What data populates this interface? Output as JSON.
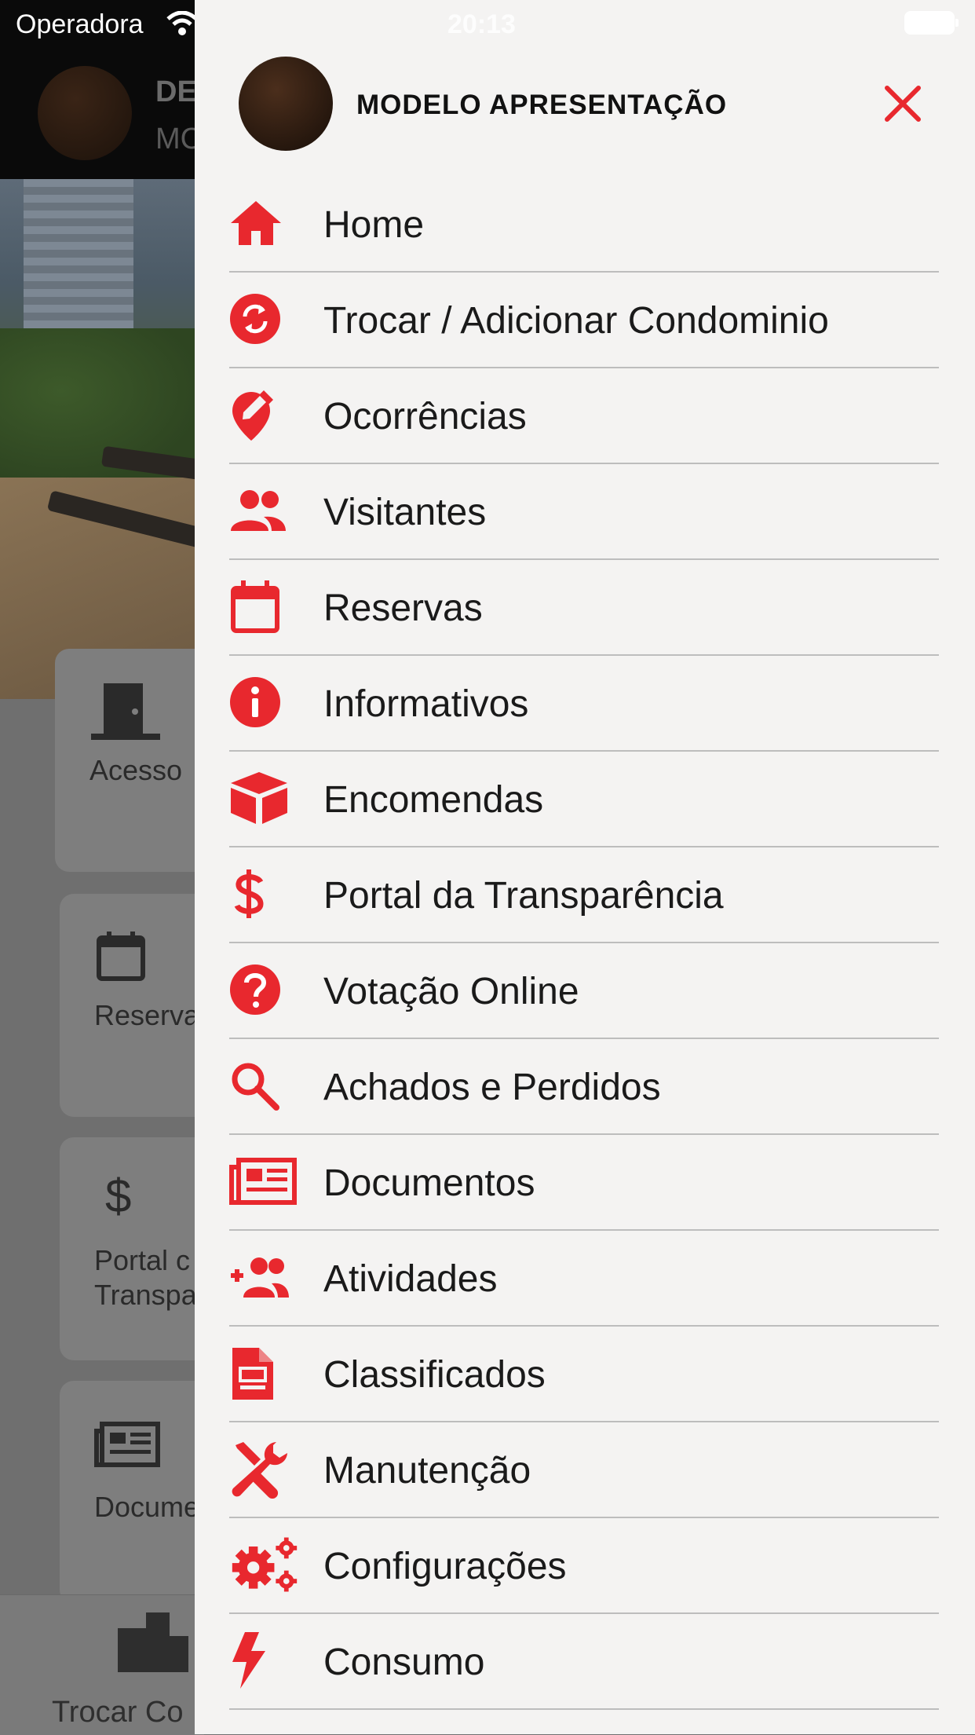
{
  "status_bar": {
    "carrier": "Operadora",
    "time": "20:13"
  },
  "background": {
    "header_title": "DE",
    "header_subtitle": "MC",
    "cards": [
      {
        "label": "Acesso",
        "icon": "door-icon"
      },
      {
        "label": "Reserva",
        "icon": "calendar-icon"
      },
      {
        "label_line1": "Portal c",
        "label_line2": "Transpa",
        "icon": "dollar-icon"
      },
      {
        "label": "Docume",
        "icon": "newspaper-icon"
      }
    ],
    "tabbar_label": "Trocar Co"
  },
  "drawer": {
    "user_name": "MODELO APRESENTAÇÃO",
    "accent_color": "#e8282e",
    "items": [
      {
        "label": "Home",
        "icon": "home-icon"
      },
      {
        "label": "Trocar / Adicionar Condominio",
        "icon": "swap-circle-icon"
      },
      {
        "label": "Ocorrências",
        "icon": "location-edit-icon"
      },
      {
        "label": "Visitantes",
        "icon": "people-icon"
      },
      {
        "label": "Reservas",
        "icon": "calendar-icon"
      },
      {
        "label": "Informativos",
        "icon": "info-icon"
      },
      {
        "label": "Encomendas",
        "icon": "box-icon"
      },
      {
        "label": "Portal da Transparência",
        "icon": "dollar-icon"
      },
      {
        "label": "Votação Online",
        "icon": "question-icon"
      },
      {
        "label": "Achados e Perdidos",
        "icon": "search-icon"
      },
      {
        "label": "Documentos",
        "icon": "newspaper-icon"
      },
      {
        "label": "Atividades",
        "icon": "group-add-icon"
      },
      {
        "label": "Classificados",
        "icon": "document-icon"
      },
      {
        "label": "Manutenção",
        "icon": "tools-icon"
      },
      {
        "label": "Configurações",
        "icon": "gears-icon"
      },
      {
        "label": "Consumo",
        "icon": "bolt-icon"
      }
    ]
  }
}
